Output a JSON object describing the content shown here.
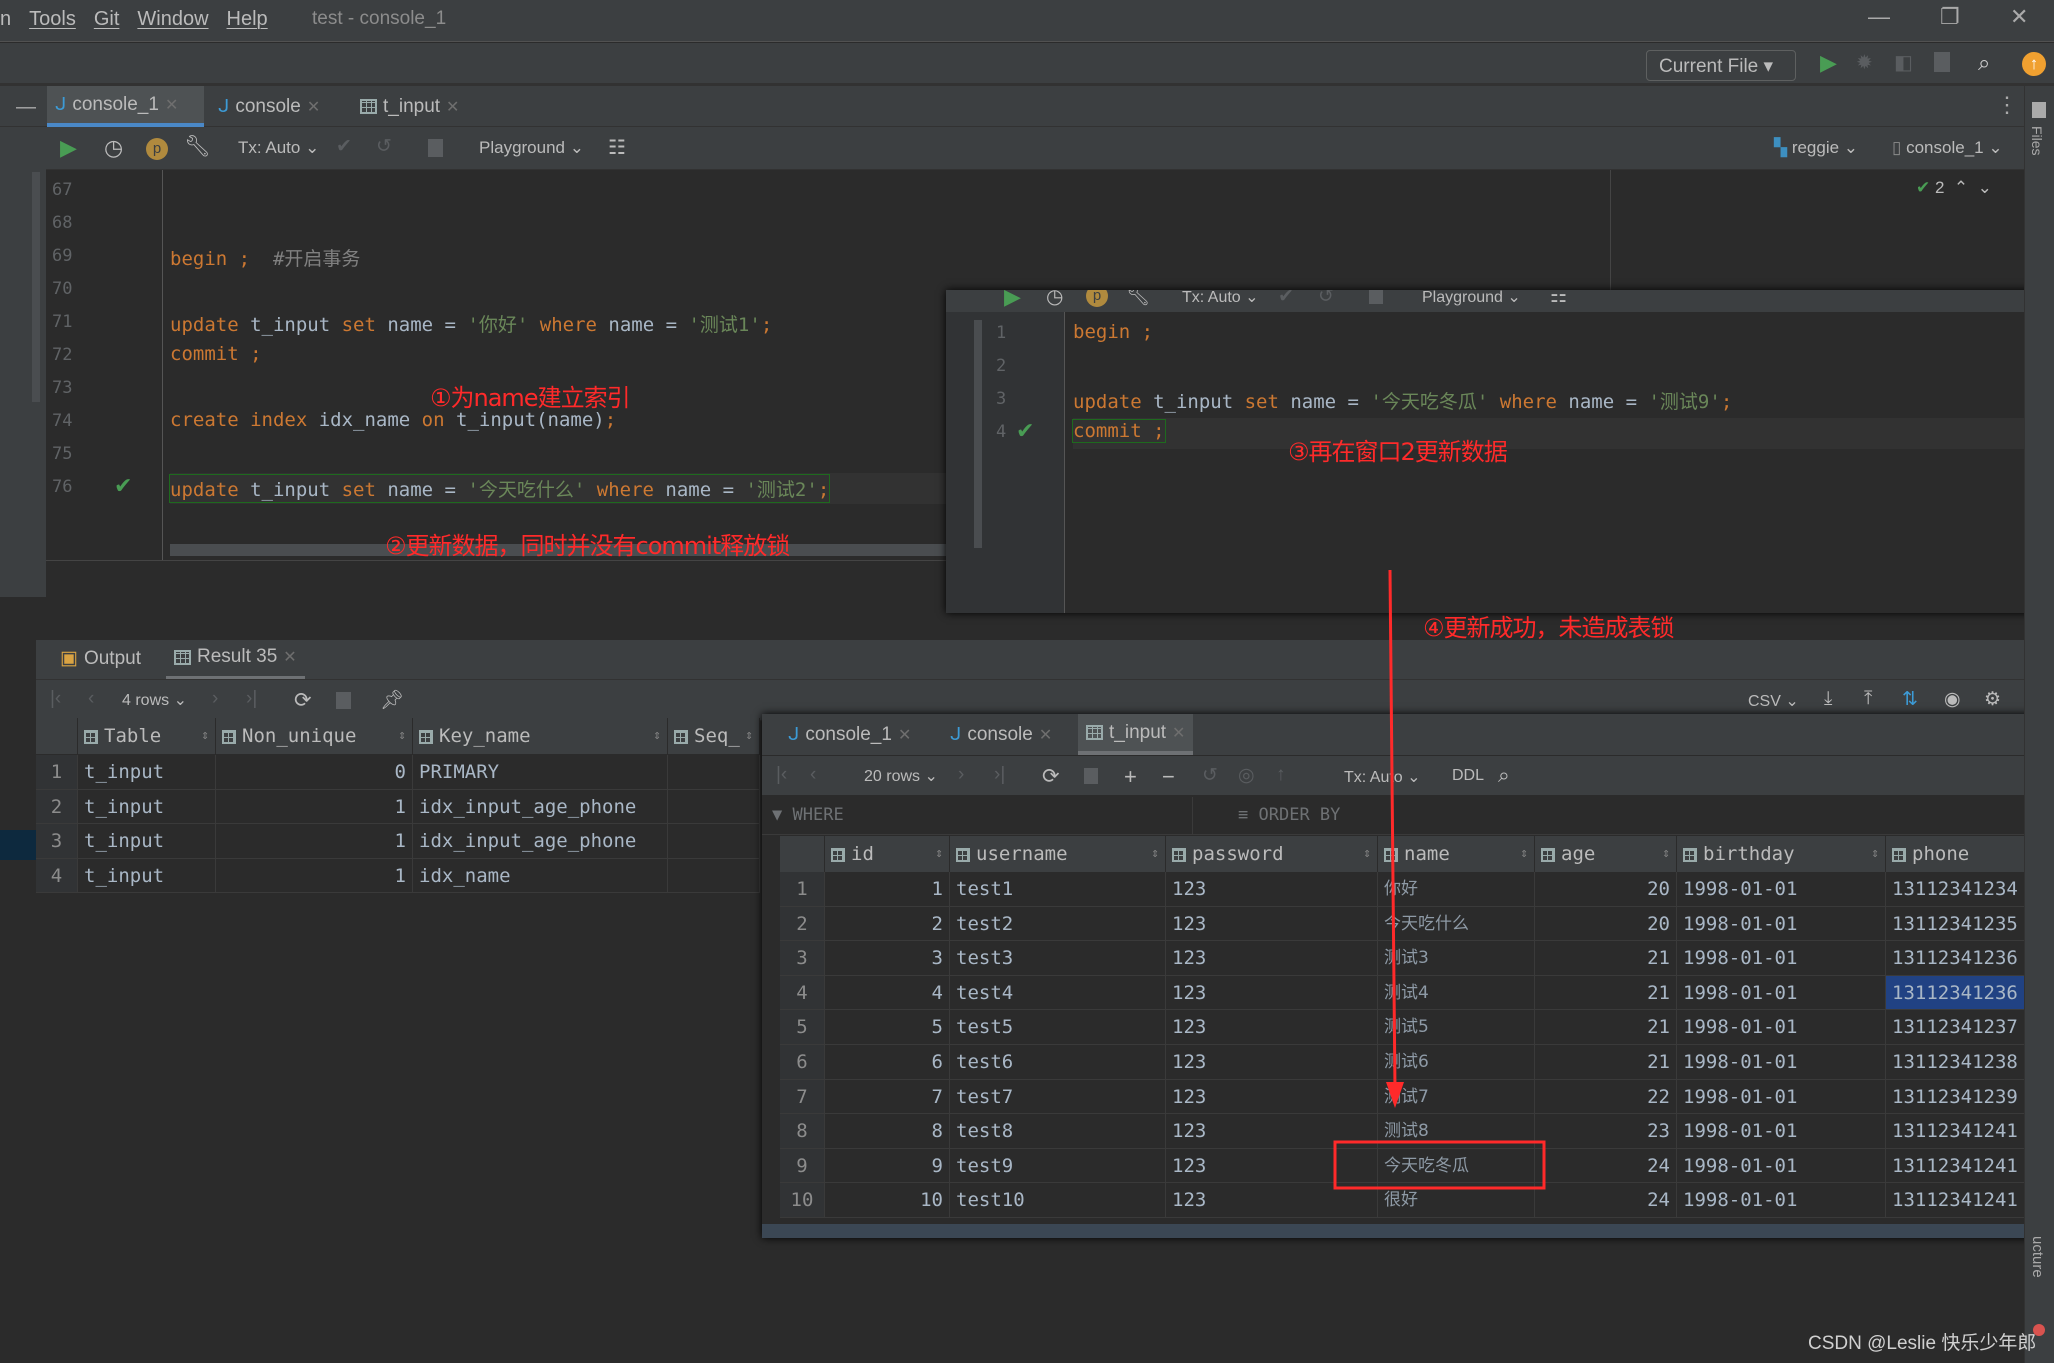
{
  "window": {
    "title": "test - console_1",
    "menu": [
      "n",
      "Tools",
      "Git",
      "Window",
      "Help"
    ]
  },
  "run_toolbar": {
    "config": "Current File"
  },
  "editor_tabs": [
    {
      "label": "console_1",
      "icon": "mysql-dolphin-icon"
    },
    {
      "label": "console",
      "icon": "mysql-dolphin-icon"
    },
    {
      "label": "t_input",
      "icon": "table-icon"
    }
  ],
  "editor_toolbar": {
    "tx": "Tx: Auto",
    "mode": "Playground",
    "schema": "reggie",
    "session": "console_1",
    "inspections": "2"
  },
  "editor1": {
    "lines": [
      {
        "n": "67",
        "tokens": []
      },
      {
        "n": "68",
        "tokens": []
      },
      {
        "n": "69",
        "tokens": [
          {
            "t": "begin ;",
            "c": "kw"
          },
          {
            "t": "  #开启事务",
            "c": "cm"
          }
        ]
      },
      {
        "n": "70",
        "tokens": []
      },
      {
        "n": "71",
        "tokens": [
          {
            "t": "update ",
            "c": "kw"
          },
          {
            "t": "t_input ",
            "c": "id"
          },
          {
            "t": "set ",
            "c": "kw"
          },
          {
            "t": "name = ",
            "c": "id"
          },
          {
            "t": "'你好' ",
            "c": "str"
          },
          {
            "t": "where ",
            "c": "kw"
          },
          {
            "t": "name = ",
            "c": "id"
          },
          {
            "t": "'测试1'",
            "c": "str"
          },
          {
            "t": ";",
            "c": "kw"
          }
        ]
      },
      {
        "n": "72",
        "tokens": [
          {
            "t": "commit ;",
            "c": "kw"
          }
        ]
      },
      {
        "n": "73",
        "tokens": []
      },
      {
        "n": "74",
        "tokens": [
          {
            "t": "create index ",
            "c": "kw"
          },
          {
            "t": "idx_name ",
            "c": "id"
          },
          {
            "t": "on ",
            "c": "kw"
          },
          {
            "t": "t_input(name)",
            "c": "id"
          },
          {
            "t": ";",
            "c": "kw"
          }
        ]
      },
      {
        "n": "75",
        "tokens": []
      },
      {
        "n": "76",
        "tokens": [
          {
            "t": "update ",
            "c": "kw"
          },
          {
            "t": "t_input ",
            "c": "id"
          },
          {
            "t": "set ",
            "c": "kw"
          },
          {
            "t": "name = ",
            "c": "id"
          },
          {
            "t": "'今天吃什么' ",
            "c": "str"
          },
          {
            "t": "where ",
            "c": "kw"
          },
          {
            "t": "name = ",
            "c": "id"
          },
          {
            "t": "'测试2'",
            "c": "str"
          },
          {
            "t": ";",
            "c": "kw"
          }
        ],
        "check": true
      }
    ]
  },
  "editor2": {
    "tx": "Tx: Auto",
    "mode": "Playground",
    "lines": [
      {
        "n": "1",
        "tokens": [
          {
            "t": "begin ;",
            "c": "kw"
          }
        ]
      },
      {
        "n": "2",
        "tokens": []
      },
      {
        "n": "3",
        "tokens": [
          {
            "t": "update ",
            "c": "kw"
          },
          {
            "t": "t_input ",
            "c": "id"
          },
          {
            "t": "set ",
            "c": "kw"
          },
          {
            "t": "name = ",
            "c": "id"
          },
          {
            "t": "'今天吃冬瓜' ",
            "c": "str"
          },
          {
            "t": "where ",
            "c": "kw"
          },
          {
            "t": "name = ",
            "c": "id"
          },
          {
            "t": "'测试9'",
            "c": "str"
          },
          {
            "t": ";",
            "c": "kw"
          }
        ]
      },
      {
        "n": "4",
        "tokens": [
          {
            "t": "commit ;",
            "c": "kw"
          }
        ],
        "check": true
      }
    ]
  },
  "annotations": {
    "a1": "①为name建立索引",
    "a2": "②更新数据，同时并没有commit释放锁",
    "a3": "③再在窗口2更新数据",
    "a4": "④更新成功，未造成表锁",
    "color": "#ff2a2a"
  },
  "results": {
    "tabs": [
      "Output",
      "Result 35"
    ],
    "rows_label": "4 rows",
    "export": "CSV",
    "columns": [
      "Table",
      "Non_unique",
      "Key_name",
      "Seq_"
    ],
    "rows": [
      [
        "1",
        "t_input",
        "0",
        "PRIMARY"
      ],
      [
        "2",
        "t_input",
        "1",
        "idx_input_age_phone"
      ],
      [
        "3",
        "t_input",
        "1",
        "idx_input_age_phone"
      ],
      [
        "4",
        "t_input",
        "1",
        "idx_name"
      ]
    ]
  },
  "table_view": {
    "tabs": [
      "console_1",
      "console",
      "t_input"
    ],
    "rows_label": "20 rows",
    "tx": "Tx: Auto",
    "ddl": "DDL",
    "where": "WHERE",
    "order_by": "ORDER BY",
    "columns": [
      "id",
      "username",
      "password",
      "name",
      "age",
      "birthday",
      "phone"
    ],
    "rows": [
      [
        "1",
        "1",
        "test1",
        "123",
        "你好",
        "20",
        "1998-01-01",
        "13112341234"
      ],
      [
        "2",
        "2",
        "test2",
        "123",
        "今天吃什么",
        "20",
        "1998-01-01",
        "13112341235"
      ],
      [
        "3",
        "3",
        "test3",
        "123",
        "测试3",
        "21",
        "1998-01-01",
        "13112341236"
      ],
      [
        "4",
        "4",
        "test4",
        "123",
        "测试4",
        "21",
        "1998-01-01",
        "13112341236"
      ],
      [
        "5",
        "5",
        "test5",
        "123",
        "测试5",
        "21",
        "1998-01-01",
        "13112341237"
      ],
      [
        "6",
        "6",
        "test6",
        "123",
        "测试6",
        "21",
        "1998-01-01",
        "13112341238"
      ],
      [
        "7",
        "7",
        "test7",
        "123",
        "测试7",
        "22",
        "1998-01-01",
        "13112341239"
      ],
      [
        "8",
        "8",
        "test8",
        "123",
        "测试8",
        "23",
        "1998-01-01",
        "13112341241"
      ],
      [
        "9",
        "9",
        "test9",
        "123",
        "今天吃冬瓜",
        "24",
        "1998-01-01",
        "13112341241"
      ],
      [
        "10",
        "10",
        "test10",
        "123",
        "很好",
        "24",
        "1998-01-01",
        "13112341241"
      ]
    ],
    "selected_cell": "13112341236"
  },
  "sidebar": {
    "files": "Files",
    "structure": "ucture"
  },
  "watermark": "CSDN @Leslie 快乐少年郎"
}
